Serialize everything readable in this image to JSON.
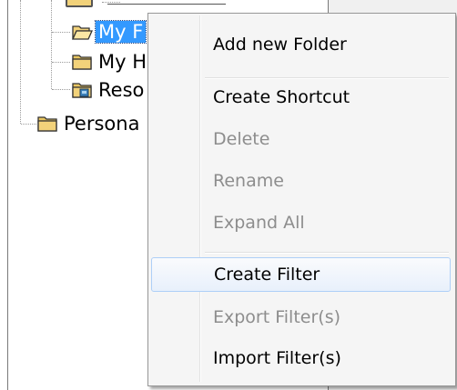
{
  "tree": {
    "nodes": [
      {
        "label": "My F",
        "selected": true,
        "icon": "open-folder-icon"
      },
      {
        "label": "My H",
        "selected": false,
        "icon": "folder-icon"
      },
      {
        "label": "Reso",
        "selected": false,
        "icon": "shared-folder-icon"
      },
      {
        "label": "Persona",
        "selected": false,
        "icon": "folder-icon"
      }
    ]
  },
  "context_menu": {
    "items": [
      {
        "label": "Add new Folder",
        "enabled": true
      },
      {
        "label": "Create Shortcut",
        "enabled": true
      },
      {
        "label": "Delete",
        "enabled": false
      },
      {
        "label": "Rename",
        "enabled": false
      },
      {
        "label": "Expand All",
        "enabled": false
      },
      {
        "label": "Create Filter",
        "enabled": true,
        "highlighted": true
      },
      {
        "label": "Export Filter(s)",
        "enabled": false
      },
      {
        "label": "Import Filter(s)",
        "enabled": true
      }
    ]
  },
  "colors": {
    "selection": "#3399ff",
    "menu_background": "#f5f5f5",
    "disabled_text": "#8d8d8d",
    "folder": "#e8c560"
  }
}
